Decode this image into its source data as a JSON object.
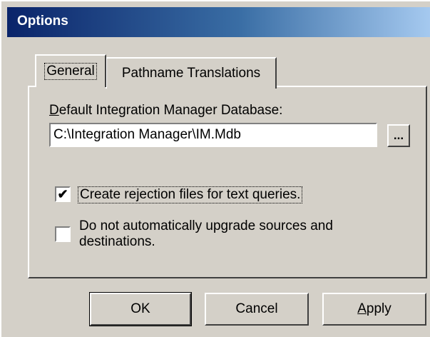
{
  "window": {
    "title": "Options"
  },
  "tabs": [
    {
      "label": "General",
      "selected": true
    },
    {
      "label": "Pathname Translations",
      "selected": false
    }
  ],
  "general": {
    "db_label_accel": "D",
    "db_label_rest": "efault Integration Manager Database:",
    "db_path": "C:\\Integration Manager\\IM.Mdb",
    "browse_label": "...",
    "checkbox_rejection": {
      "label": "Create rejection files for text queries.",
      "checked": true,
      "mark": "✔"
    },
    "checkbox_upgrade": {
      "label": "Do not automatically upgrade sources and destinations.",
      "checked": false,
      "mark": ""
    }
  },
  "buttons": {
    "ok_label": "OK",
    "cancel_label": "Cancel",
    "apply_accel": "A",
    "apply_rest": "pply"
  }
}
